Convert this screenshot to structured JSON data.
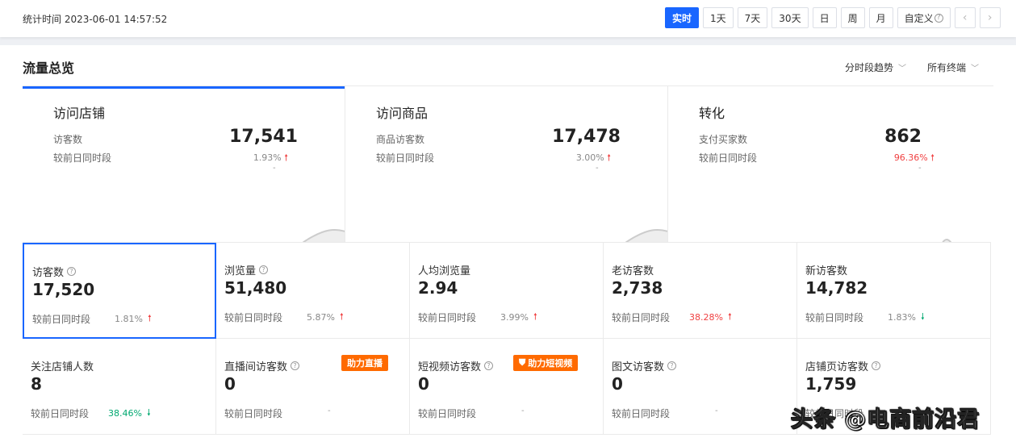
{
  "header": {
    "stat_time": "统计时间 2023-06-01 14:57:52",
    "periods": [
      "实时",
      "1天",
      "7天",
      "30天",
      "日",
      "周",
      "月",
      "自定义"
    ],
    "active_period": "实时",
    "prev": "‹",
    "next": "›"
  },
  "panel": {
    "title": "流量总览",
    "dropdown1": "分时段趋势",
    "dropdown2": "所有终端"
  },
  "trend_cards": [
    {
      "title": "访问店铺",
      "metric": "访客数",
      "compare": "较前日同时段",
      "value": "17,541",
      "pct": "1.93%",
      "dir": "up",
      "dash": "-"
    },
    {
      "title": "访问商品",
      "metric": "商品访客数",
      "compare": "较前日同时段",
      "value": "17,478",
      "pct": "3.00%",
      "dir": "up",
      "dash": "-"
    },
    {
      "title": "转化",
      "metric": "支付买家数",
      "compare": "较前日同时段",
      "value": "862",
      "pct": "96.36%",
      "dir": "up",
      "dash": "-"
    }
  ],
  "metrics": [
    {
      "name": "访客数",
      "help": true,
      "value": "17,520",
      "compare": "较前日同时段",
      "pct": "1.81%",
      "dir": "up",
      "pct_color": "#888"
    },
    {
      "name": "浏览量",
      "help": true,
      "value": "51,480",
      "compare": "较前日同时段",
      "pct": "5.87%",
      "dir": "up",
      "pct_color": "#888"
    },
    {
      "name": "人均浏览量",
      "help": false,
      "value": "2.94",
      "compare": "较前日同时段",
      "pct": "3.99%",
      "dir": "up",
      "pct_color": "#888"
    },
    {
      "name": "老访客数",
      "help": false,
      "value": "2,738",
      "compare": "较前日同时段",
      "pct": "38.28%",
      "dir": "up",
      "pct_color": "#f04142"
    },
    {
      "name": "新访客数",
      "help": false,
      "value": "14,782",
      "compare": "较前日同时段",
      "pct": "1.83%",
      "dir": "down",
      "pct_color": "#888"
    },
    {
      "name": "关注店铺人数",
      "help": false,
      "value": "8",
      "compare": "较前日同时段",
      "pct": "38.46%",
      "dir": "down",
      "pct_color": "#00a870"
    },
    {
      "name": "直播间访客数",
      "help": true,
      "value": "0",
      "compare": "较前日同时段",
      "pct": "-",
      "dir": "none",
      "tag": "助力直播"
    },
    {
      "name": "短视频访客数",
      "help": true,
      "value": "0",
      "compare": "较前日同时段",
      "pct": "-",
      "dir": "none",
      "tag": "助力短视频"
    },
    {
      "name": "图文访客数",
      "help": true,
      "value": "0",
      "compare": "较前日同时段",
      "pct": "-",
      "dir": "none"
    },
    {
      "name": "店铺页访客数",
      "help": true,
      "value": "1,759",
      "compare": "较前日同时段",
      "pct": "",
      "dir": "none"
    }
  ],
  "colors": {
    "accent": "#1966ff",
    "up": "#f04142",
    "down": "#00a870",
    "tag": "#ff6a00"
  },
  "watermark": "头条 @电商前沿君"
}
